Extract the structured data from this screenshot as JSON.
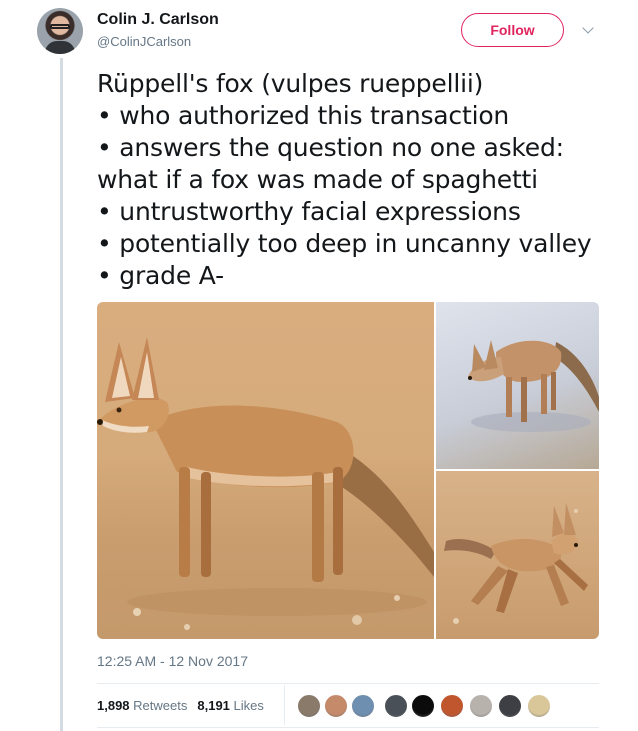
{
  "author": {
    "name": "Colin J. Carlson",
    "handle": "@ColinJCarlson"
  },
  "follow_label": "Follow",
  "tweet_lines": [
    "Rüppell's fox (vulpes rueppellii)",
    "• who authorized this transaction",
    "• answers the question no one asked:",
    "what if a fox was made of spaghetti",
    "• untrustworthy facial expressions",
    "• potentially too deep in uncanny valley",
    "• grade A-"
  ],
  "timestamp": "12:25 AM - 12 Nov 2017",
  "stats": {
    "retweets_count": "1,898",
    "retweets_label": "Retweets",
    "likes_count": "8,191",
    "likes_label": "Likes"
  },
  "colors": {
    "follow_accent": "#e0245e",
    "secondary_text": "#657786"
  },
  "likers": [
    {
      "icon": "liker-avatar-1",
      "color": "#8a7a6a"
    },
    {
      "icon": "liker-avatar-2",
      "color": "#c48a6a"
    },
    {
      "icon": "liker-avatar-3",
      "color": "#6f8fb0"
    },
    {
      "icon": "liker-avatar-4",
      "color": "#4a5058"
    },
    {
      "icon": "liker-avatar-5",
      "color": "#0b0b0b"
    },
    {
      "icon": "liker-avatar-6",
      "color": "#c0562e"
    },
    {
      "icon": "liker-avatar-7",
      "color": "#b8b2ad"
    },
    {
      "icon": "liker-avatar-8",
      "color": "#3d3f44"
    },
    {
      "icon": "liker-avatar-9",
      "color": "#d9c79a"
    }
  ]
}
